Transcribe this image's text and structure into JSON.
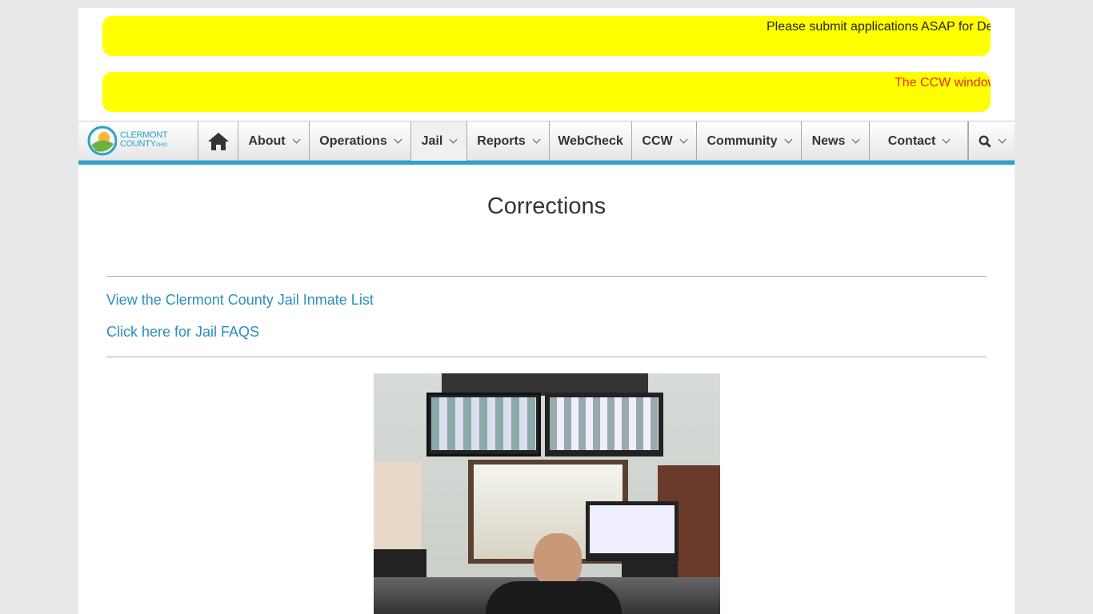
{
  "banners": [
    "Please submit applications ASAP for De",
    "The CCW window"
  ],
  "logo": {
    "line1": "CLERMONT",
    "line2": "COUNTY",
    "line3": "OHIO"
  },
  "nav": {
    "items": [
      {
        "label": "About",
        "dropdown": true
      },
      {
        "label": "Operations",
        "dropdown": true
      },
      {
        "label": "Jail",
        "dropdown": true,
        "active": true
      },
      {
        "label": "Reports",
        "dropdown": true
      },
      {
        "label": "WebCheck",
        "dropdown": false
      },
      {
        "label": "CCW",
        "dropdown": true
      },
      {
        "label": "Community",
        "dropdown": true
      },
      {
        "label": "News",
        "dropdown": true
      },
      {
        "label": "Contact",
        "dropdown": true
      }
    ],
    "accent": "#29a3d1"
  },
  "page": {
    "title": "Corrections",
    "links": [
      "View the Clermont County Jail Inmate List",
      "Click here for Jail FAQS"
    ]
  }
}
